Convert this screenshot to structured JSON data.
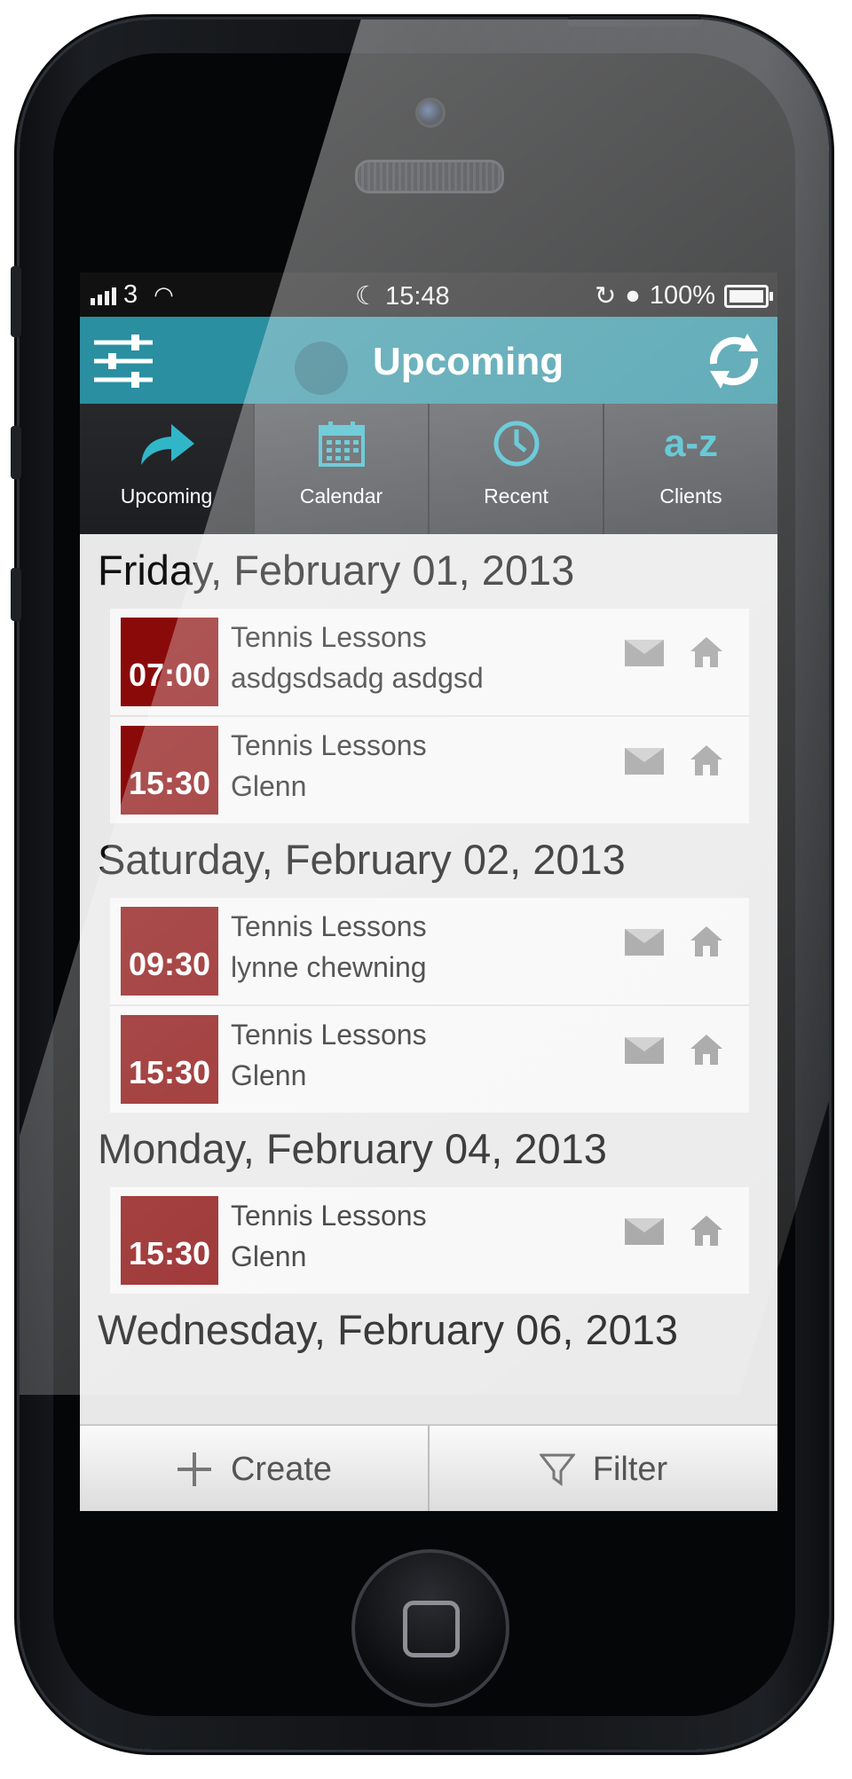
{
  "status_bar": {
    "carrier": "3",
    "time": "15:48",
    "battery": "100%"
  },
  "header": {
    "title": "Upcoming",
    "left_icon": "settings-sliders-icon",
    "right_icon": "refresh-icon",
    "accent_color": "#2a8fa0"
  },
  "tabs": [
    {
      "label": "Upcoming",
      "icon": "arrow-forward-icon",
      "active": true
    },
    {
      "label": "Calendar",
      "icon": "calendar-icon",
      "active": false
    },
    {
      "label": "Recent",
      "icon": "clock-icon",
      "active": false
    },
    {
      "label": "Clients",
      "icon": "a-z-icon",
      "icon_text": "a-z",
      "active": false
    }
  ],
  "schedule": [
    {
      "date": "Friday, February 01, 2013",
      "events": [
        {
          "time": "07:00",
          "title": "Tennis Lessons",
          "client": "asdgsdsadg asdgsd"
        },
        {
          "time": "15:30",
          "title": "Tennis Lessons",
          "client": "Glenn"
        }
      ]
    },
    {
      "date": "Saturday, February 02, 2013",
      "events": [
        {
          "time": "09:30",
          "title": "Tennis Lessons",
          "client": "lynne chewning"
        },
        {
          "time": "15:30",
          "title": "Tennis Lessons",
          "client": "Glenn"
        }
      ]
    },
    {
      "date": "Monday, February 04, 2013",
      "events": [
        {
          "time": "15:30",
          "title": "Tennis Lessons",
          "client": "Glenn"
        }
      ]
    },
    {
      "date": "Wednesday, February 06, 2013",
      "events": []
    }
  ],
  "footer": {
    "create_label": "Create",
    "filter_label": "Filter"
  },
  "colors": {
    "time_badge": "#8a0a0a",
    "tab_icon": "#31b6c8"
  }
}
